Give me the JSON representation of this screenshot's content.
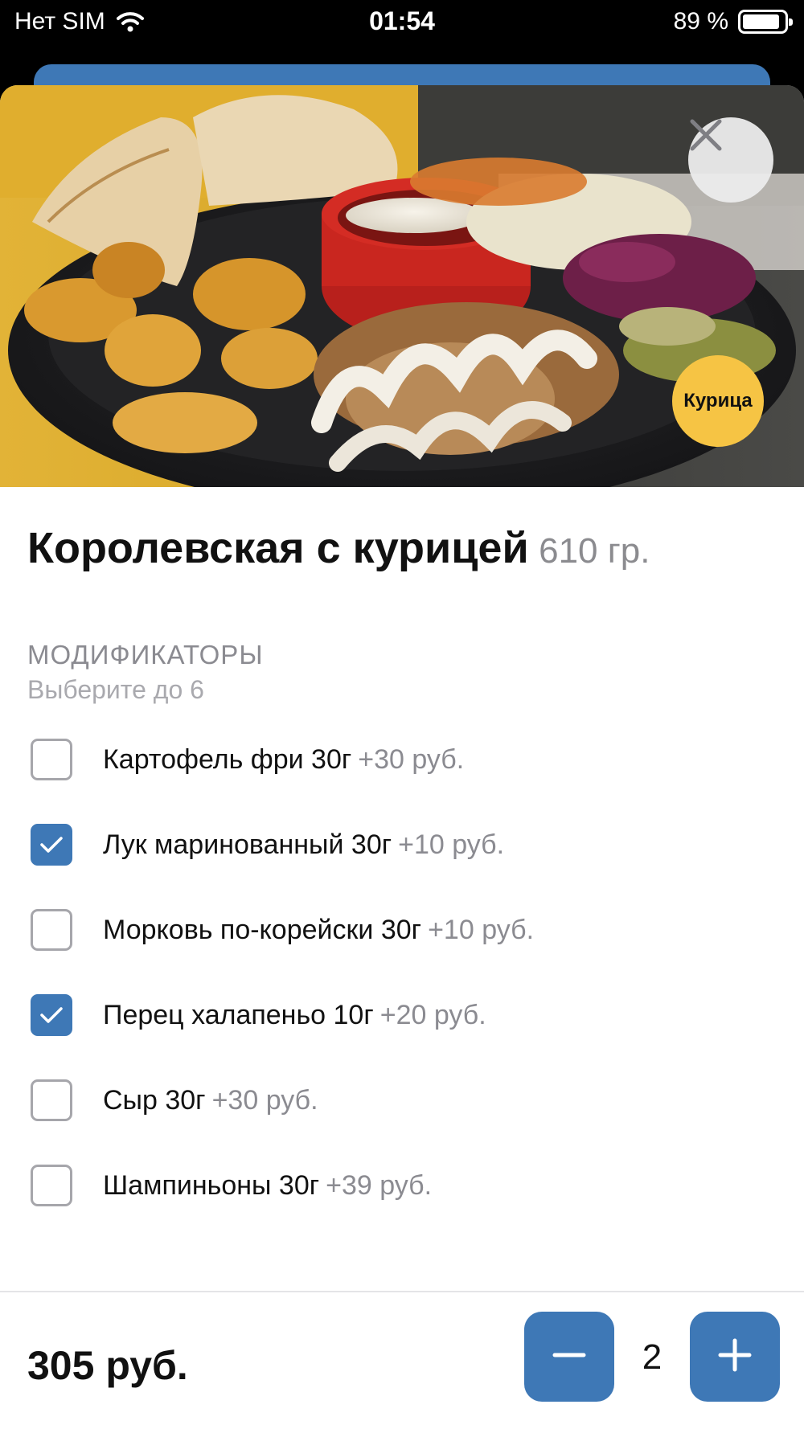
{
  "status_bar": {
    "carrier": "Нет SIM",
    "time": "01:54",
    "battery": "89 %",
    "battery_level": 0.89,
    "wifi_icon": "wifi-icon"
  },
  "product": {
    "photo_alt": "",
    "close_icon": "close-icon",
    "tag": "Курица",
    "title": "Королевская с курицей",
    "weight": "610 гр."
  },
  "modifiers": {
    "heading": "МОДИФИКАТОРЫ",
    "subheading": "Выберите до 6",
    "items": [
      {
        "name": "Картофель фри 30г",
        "price": "+30 руб.",
        "checked": false
      },
      {
        "name": "Лук маринованный 30г",
        "price": "+10 руб.",
        "checked": true
      },
      {
        "name": "Морковь по-корейски 30г",
        "price": "+10 руб.",
        "checked": false
      },
      {
        "name": "Перец халапеньо 10г",
        "price": "+20 руб.",
        "checked": true
      },
      {
        "name": "Сыр 30г",
        "price": "+30 руб.",
        "checked": false
      },
      {
        "name": "Шампиньоны 30г",
        "price": "+39 руб.",
        "checked": false
      }
    ]
  },
  "footer": {
    "total": "305 руб.",
    "quantity": "2",
    "minus_icon": "minus-icon",
    "plus_icon": "plus-icon"
  },
  "colors": {
    "accent": "#3e78b6",
    "badge": "#f6c444",
    "muted": "#8b8b91"
  }
}
